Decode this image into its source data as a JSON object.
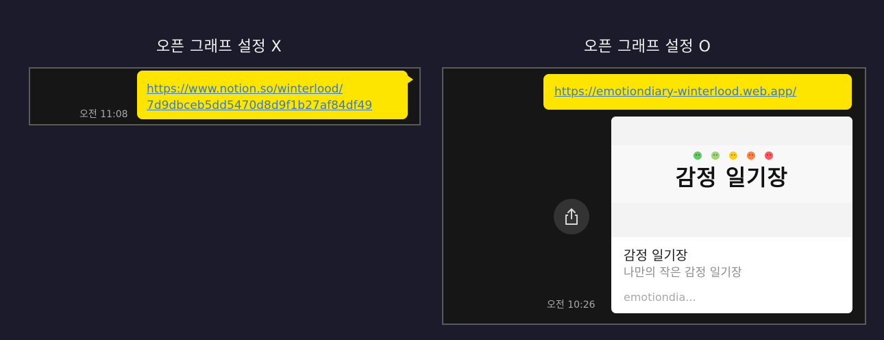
{
  "headings": {
    "left": "오픈 그래프 설정 X",
    "right": "오픈 그래프 설정 O"
  },
  "left_chat": {
    "link_line1": "https://www.notion.so/winterlood/",
    "link_line2": "7d9dbceb5dd5470d8d9f1b27af84df49",
    "time": "오전 11:08"
  },
  "right_chat": {
    "link": "https://emotiondiary-winterlood.web.app/",
    "time": "오전 10:26",
    "preview": {
      "image_title": "감정 일기장",
      "image_subtitle": "",
      "title": "감정 일기장",
      "description": "나만의 작은 감정 일기장",
      "domain": "emotiondia..."
    },
    "share_icon": "share-icon"
  },
  "colors": {
    "background": "#1b1b2b",
    "chat_bg": "#161616",
    "bubble": "#fee500",
    "link": "#3b7cc2",
    "emotions": [
      "#64c964",
      "#9dd772",
      "#fdce17",
      "#fd8446",
      "#fd565f"
    ]
  }
}
